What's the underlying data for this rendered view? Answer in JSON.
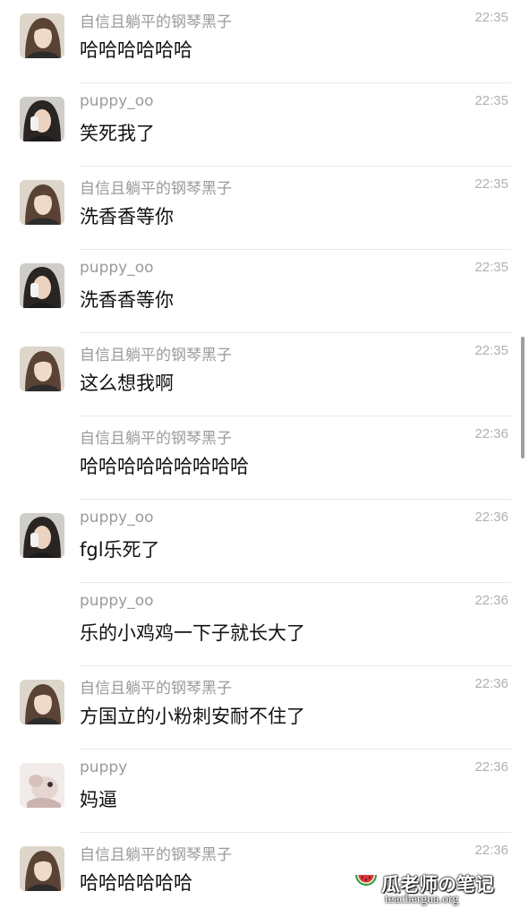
{
  "messages": [
    {
      "sender": "自信且躺平的钢琴黑子",
      "time": "22:35",
      "text": "哈哈哈哈哈哈",
      "avatar": "avatar-a"
    },
    {
      "sender": "puppy_oo",
      "time": "22:35",
      "text": "笑死我了",
      "avatar": "avatar-b"
    },
    {
      "sender": "自信且躺平的钢琴黑子",
      "time": "22:35",
      "text": "洗香香等你",
      "avatar": "avatar-a"
    },
    {
      "sender": "puppy_oo",
      "time": "22:35",
      "text": "洗香香等你",
      "avatar": "avatar-b"
    },
    {
      "sender": "自信且躺平的钢琴黑子",
      "time": "22:35",
      "text": "这么想我啊",
      "avatar": "avatar-a"
    },
    {
      "sender": "自信且躺平的钢琴黑子",
      "time": "22:36",
      "text": "哈哈哈哈哈哈哈哈哈",
      "avatar": "none"
    },
    {
      "sender": "puppy_oo",
      "time": "22:36",
      "text": "fgl乐死了",
      "avatar": "avatar-b"
    },
    {
      "sender": "puppy_oo",
      "time": "22:36",
      "text": "乐的小鸡鸡一下子就长大了",
      "avatar": "none"
    },
    {
      "sender": "自信且躺平的钢琴黑子",
      "time": "22:36",
      "text": "方国立的小粉刺安耐不住了",
      "avatar": "avatar-a"
    },
    {
      "sender": "puppy",
      "time": "22:36",
      "text": "妈逼",
      "avatar": "avatar-c"
    },
    {
      "sender": "自信且躺平的钢琴黑子",
      "time": "22:36",
      "text": "哈哈哈哈哈哈",
      "avatar": "avatar-a"
    }
  ],
  "watermark": {
    "title": "瓜老师の笔记",
    "url": "teachergua.org",
    "icon": "watermelon-icon"
  },
  "colors": {
    "sender": "#9a9a9a",
    "time": "#b0b0b0",
    "text": "#111111",
    "divider": "#e9e9e9"
  }
}
